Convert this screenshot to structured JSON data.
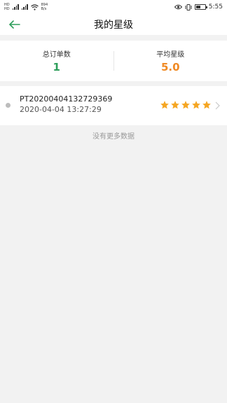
{
  "status_bar": {
    "left_tags": [
      "HD",
      "HD"
    ],
    "net_speed_value": "894",
    "net_speed_unit": "B/s",
    "time": "5:55"
  },
  "header": {
    "title": "我的星级",
    "back_icon": "back-arrow-icon"
  },
  "stats": {
    "total_orders_label": "总订单数",
    "total_orders_value": "1",
    "avg_rating_label": "平均星级",
    "avg_rating_value": "5.0"
  },
  "orders": [
    {
      "id": "PT20200404132729369",
      "time": "2020-04-04 13:27:29",
      "rating": 5
    }
  ],
  "footer": {
    "no_more": "没有更多数据"
  },
  "colors": {
    "green": "#2e9e5b",
    "orange": "#f08a24",
    "star": "#f5a623"
  }
}
